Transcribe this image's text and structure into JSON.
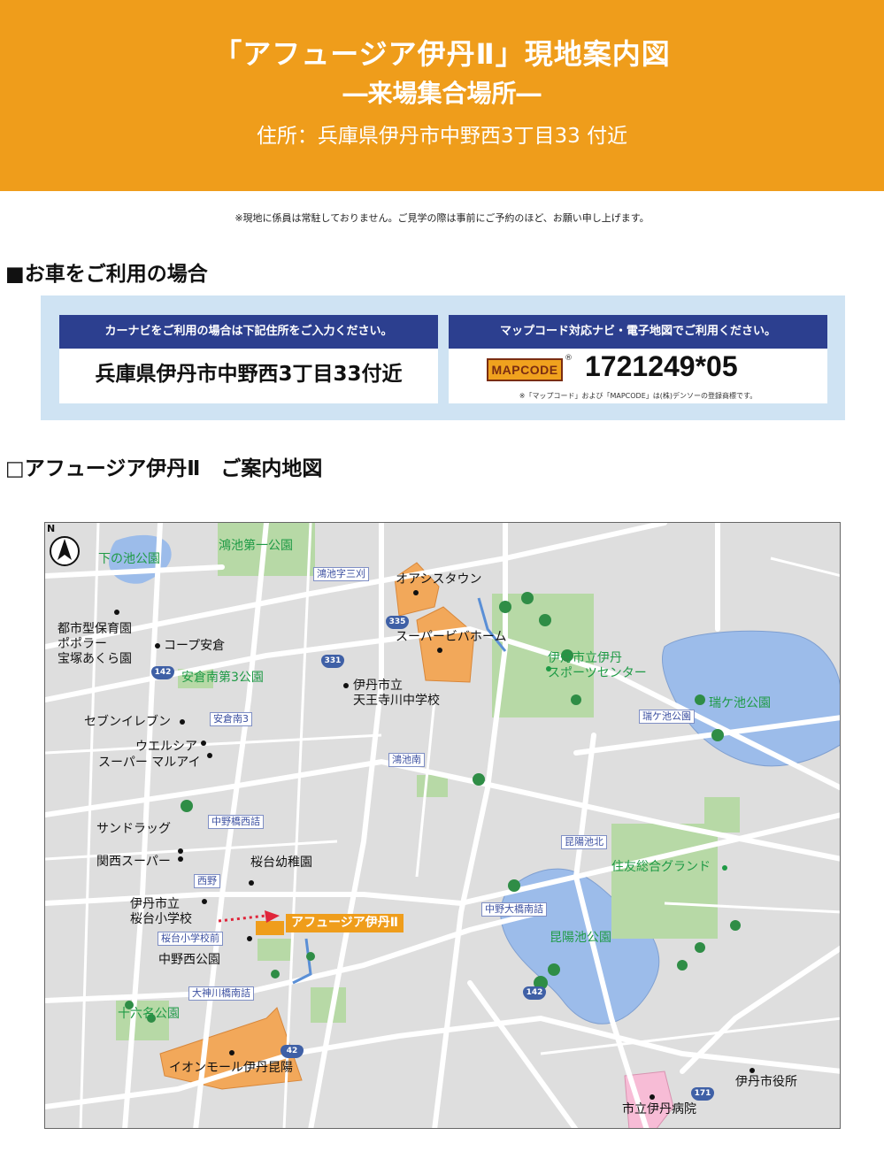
{
  "header": {
    "title": "「アフュージア伊丹Ⅱ」現地案内図",
    "subtitle": "―来場集合場所―",
    "address": "住所：兵庫県伊丹市中野西3丁目33 付近"
  },
  "notice": "※現地に係員は常駐しておりません。ご見学の際は事前にご予約のほど、お願い申し上げます。",
  "car_section": {
    "heading": "■お車をご利用の場合",
    "navi": {
      "caption": "カーナビをご利用の場合は下記住所をご入力ください。",
      "value": "兵庫県伊丹市中野西3丁目33付近"
    },
    "mapcode": {
      "caption": "マップコード対応ナビ・電子地図でご利用ください。",
      "logo": "MAPCODE",
      "registered": "®",
      "code": "1721249*05",
      "note": "※「マップコード」および「MAPCODE」は(株)デンソーの登録商標です。"
    }
  },
  "map_section": {
    "heading": "□アフュージア伊丹Ⅱ　ご案内地図",
    "destination": "アフュージア伊丹Ⅱ",
    "compass": "N",
    "places": [
      {
        "id": "shimonoike-park",
        "text": "下の池公園",
        "type": "park"
      },
      {
        "id": "kounoike-1-park",
        "text": "鴻池第一公園",
        "type": "park"
      },
      {
        "id": "oasis-town",
        "text": "オアシスタウン",
        "type": "place"
      },
      {
        "id": "super-viva-home",
        "text": "スーパービバホーム",
        "type": "place"
      },
      {
        "id": "nursery",
        "text": "都市型保育園\nポポラー\n宝塚あくら園",
        "type": "place"
      },
      {
        "id": "co-op",
        "text": "コープ安倉",
        "type": "place"
      },
      {
        "id": "akuraminami-3-park",
        "text": "安倉南第3公園",
        "type": "park"
      },
      {
        "id": "tennoujigawa-jhs",
        "text": "伊丹市立\n天王寺川中学校",
        "type": "place"
      },
      {
        "id": "sports-center",
        "text": "伊丹市立伊丹\nスポーツセンター",
        "type": "park"
      },
      {
        "id": "zuigaike-park",
        "text": "瑞ケ池公園",
        "type": "park"
      },
      {
        "id": "seven-eleven",
        "text": "セブンイレブン",
        "type": "place"
      },
      {
        "id": "welcia",
        "text": "ウエルシア",
        "type": "place"
      },
      {
        "id": "marui",
        "text": "スーパー マルアイ",
        "type": "place"
      },
      {
        "id": "sundrug",
        "text": "サンドラッグ",
        "type": "place"
      },
      {
        "id": "kansai-super",
        "text": "関西スーパー",
        "type": "place"
      },
      {
        "id": "sakuradai-kindergarten",
        "text": "桜台幼稚園",
        "type": "place"
      },
      {
        "id": "sakuradai-es",
        "text": "伊丹市立\n桜台小学校",
        "type": "place"
      },
      {
        "id": "nakanonishi-park",
        "text": "中野西公園",
        "type": "place"
      },
      {
        "id": "sumitomo-ground",
        "text": "住友総合グランド",
        "type": "park"
      },
      {
        "id": "koyaike-park",
        "text": "昆陽池公園",
        "type": "park"
      },
      {
        "id": "jurokumei-park",
        "text": "十六名公園",
        "type": "park"
      },
      {
        "id": "aeon-mall",
        "text": "イオンモール伊丹昆陽",
        "type": "place"
      },
      {
        "id": "city-hall",
        "text": "伊丹市役所",
        "type": "place"
      },
      {
        "id": "city-hospital",
        "text": "市立伊丹病院",
        "type": "place"
      }
    ],
    "signals": [
      {
        "id": "kounoike-azasankari",
        "text": "鴻池字三刈"
      },
      {
        "id": "akuraminami-3",
        "text": "安倉南3"
      },
      {
        "id": "zuigaike-park-sig",
        "text": "瑞ケ池公園"
      },
      {
        "id": "kounoikeminami",
        "text": "鴻池南"
      },
      {
        "id": "nakanohashi-nishizume",
        "text": "中野橋西詰"
      },
      {
        "id": "koyaike-kita",
        "text": "昆陽池北"
      },
      {
        "id": "nishino",
        "text": "西野"
      },
      {
        "id": "nakano-ohashi-minamizume",
        "text": "中野大橋南詰"
      },
      {
        "id": "sakuradai-es-mae",
        "text": "桜台小学校前"
      },
      {
        "id": "oogamigawa-bashi-minamizume",
        "text": "大神川橋南詰"
      }
    ],
    "routes": [
      "335",
      "331",
      "142",
      "142",
      "42",
      "171"
    ],
    "colors": {
      "park": "#1e9a45",
      "water": "#9cbcea",
      "facility": "#f2a85a",
      "hospital": "#f7bcd6",
      "road": "#ffffff",
      "accent": "#ef9d1b",
      "caption_bar": "#2c3f8f",
      "panel": "#cfe3f3"
    }
  }
}
